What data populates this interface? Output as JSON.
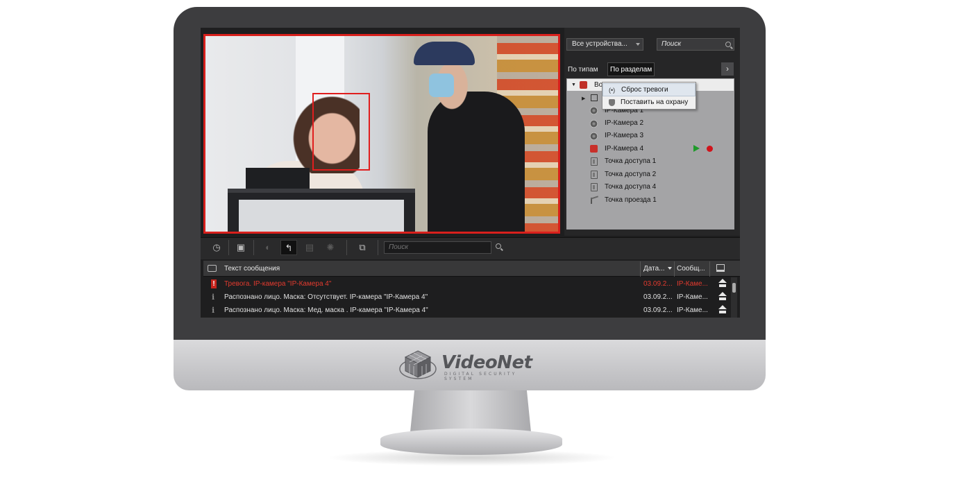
{
  "brand": {
    "name": "VideoNet",
    "tagline": "DIGITAL SECURITY SYSTEM"
  },
  "devices_panel": {
    "filter_dropdown": "Все устройства...",
    "search_placeholder": "Поиск",
    "tabs": [
      "По типам",
      "По разделам"
    ],
    "tree_root_label": "Во",
    "tree_items": [
      {
        "label": "IP-Камера 1",
        "icon": "camera-icon"
      },
      {
        "label": "IP-Камера 2",
        "icon": "camera-icon"
      },
      {
        "label": "IP-Камера 3",
        "icon": "camera-icon"
      },
      {
        "label": "IP-Камера 4",
        "icon": "camera-alarm-icon"
      },
      {
        "label": "Точка доступа 1",
        "icon": "door-icon"
      },
      {
        "label": "Точка доступа 2",
        "icon": "door-icon"
      },
      {
        "label": "Точка доступа 4",
        "icon": "door-icon"
      },
      {
        "label": "Точка проезда 1",
        "icon": "barrier-gate-icon"
      }
    ],
    "context_menu": [
      "Сброс тревоги",
      "Поставить на охрану"
    ]
  },
  "events": {
    "search_placeholder": "Поиск",
    "columns": [
      "Текст сообщения",
      "Дата...",
      "Сообщ..."
    ],
    "rows": [
      {
        "level": "alarm",
        "text": "Тревога. IP-камера \"IP-Камера 4\"",
        "date": "03.09.2...",
        "source": "IP-Каме..."
      },
      {
        "level": "info",
        "text": "Распознано лицо. Маска: Отсутствует. IP-камера \"IP-Камера 4\"",
        "date": "03.09.2...",
        "source": "IP-Каме..."
      },
      {
        "level": "info",
        "text": "Распознано лицо. Маска: Мед. маска . IP-камера \"IP-Камера 4\"",
        "date": "03.09.2...",
        "source": "IP-Каме..."
      }
    ]
  },
  "colors": {
    "alarm": "#e33b2f",
    "play": "#1f9a2a",
    "record": "#d0131b",
    "video_border": "#d8201c"
  }
}
